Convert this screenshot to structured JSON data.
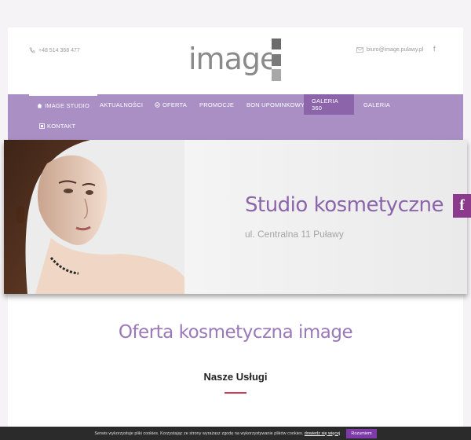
{
  "header": {
    "phone": "+48 514 368 477",
    "email": "biuro@image.pulawy.pl",
    "logo_text": "image"
  },
  "nav": {
    "items": [
      {
        "label": "IMAGE STUDIO",
        "icon": "home-icon",
        "active": false
      },
      {
        "label": "AKTUALNOŚCI",
        "icon": "",
        "active": false
      },
      {
        "label": "OFERTA",
        "icon": "circle-icon",
        "active": false
      },
      {
        "label": "PROMOCJE",
        "icon": "",
        "active": false
      },
      {
        "label": "BON UPOMINKOWY",
        "icon": "",
        "active": false
      },
      {
        "label": "GALERIA 360",
        "icon": "",
        "active": true
      },
      {
        "label": "GALERIA",
        "icon": "",
        "active": false
      },
      {
        "label": "KONTAKT",
        "icon": "contact-icon",
        "active": false
      }
    ]
  },
  "hero": {
    "title": "Studio kosmetyczne",
    "subtitle": "ul. Centralna 11 Puławy"
  },
  "section": {
    "title": "Oferta kosmetyczna image",
    "services_heading": "Nasze Usługi"
  },
  "social": {
    "facebook_glyph": "f"
  },
  "cookie": {
    "text": "Serwis wykorzystuje pliki cookies. Korzystając ze strony wyrażasz zgodę na wykorzystywanie plików cookies.",
    "link": "dowiedz się więcej",
    "button": "Rozumiem"
  },
  "colors": {
    "nav_bg": "#a98fc4",
    "nav_active": "#8b64a9",
    "accent": "#8b64a9",
    "underline": "#d23c5a"
  }
}
